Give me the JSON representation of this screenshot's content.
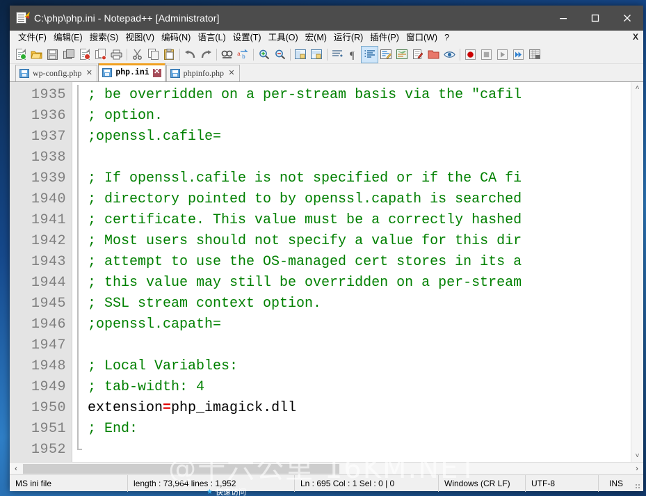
{
  "window": {
    "title": "C:\\php\\php.ini - Notepad++ [Administrator]",
    "icon": "notepad-pencil-icon",
    "controls": {
      "minimize": "–",
      "maximize": "□",
      "close": "✕"
    }
  },
  "menubar": {
    "items": [
      {
        "label": "文件(F)",
        "name": "menu-file"
      },
      {
        "label": "编辑(E)",
        "name": "menu-edit"
      },
      {
        "label": "搜索(S)",
        "name": "menu-search"
      },
      {
        "label": "视图(V)",
        "name": "menu-view"
      },
      {
        "label": "编码(N)",
        "name": "menu-encoding"
      },
      {
        "label": "语言(L)",
        "name": "menu-language"
      },
      {
        "label": "设置(T)",
        "name": "menu-settings"
      },
      {
        "label": "工具(O)",
        "name": "menu-tools"
      },
      {
        "label": "宏(M)",
        "name": "menu-macro"
      },
      {
        "label": "运行(R)",
        "name": "menu-run"
      },
      {
        "label": "插件(P)",
        "name": "menu-plugins"
      },
      {
        "label": "窗口(W)",
        "name": "menu-window"
      },
      {
        "label": "?",
        "name": "menu-help"
      }
    ],
    "close_doc_label": "X"
  },
  "toolbar": {
    "icons": [
      "new-file-icon",
      "open-file-icon",
      "save-icon",
      "save-all-icon",
      "close-file-icon",
      "close-all-icon",
      "print-icon",
      "cut-icon",
      "copy-icon",
      "paste-icon",
      "undo-icon",
      "redo-icon",
      "find-icon",
      "replace-icon",
      "zoom-in-icon",
      "zoom-out-icon",
      "sync-vertical-scroll-icon",
      "sync-horizontal-scroll-icon",
      "word-wrap-icon",
      "show-all-characters-icon",
      "indent-guide-icon",
      "user-defined-language-icon",
      "document-map-icon",
      "function-list-icon",
      "folder-as-workspace-icon",
      "monitoring-icon",
      "macro-record-icon",
      "macro-stop-icon",
      "macro-play-icon",
      "macro-playback-multiple-icon",
      "macro-save-icon"
    ]
  },
  "tabs": [
    {
      "label": "wp-config.php",
      "active": false,
      "modified": false,
      "name": "tab-wp-config-php"
    },
    {
      "label": "php.ini",
      "active": true,
      "modified": true,
      "name": "tab-php-ini"
    },
    {
      "label": "phpinfo.php",
      "active": false,
      "modified": false,
      "name": "tab-phpinfo-php"
    }
  ],
  "editor": {
    "first_line_number": 1935,
    "lines": [
      {
        "num": "1935",
        "segments": [
          {
            "cls": "cmt",
            "text": "; be overridden on a per-stream basis via the \"cafil"
          }
        ]
      },
      {
        "num": "1936",
        "segments": [
          {
            "cls": "cmt",
            "text": "; option."
          }
        ]
      },
      {
        "num": "1937",
        "segments": [
          {
            "cls": "cmt",
            "text": ";openssl.cafile="
          }
        ]
      },
      {
        "num": "1938",
        "segments": [
          {
            "cls": "cmt",
            "text": ""
          }
        ]
      },
      {
        "num": "1939",
        "segments": [
          {
            "cls": "cmt",
            "text": "; If openssl.cafile is not specified or if the CA fi"
          }
        ]
      },
      {
        "num": "1940",
        "segments": [
          {
            "cls": "cmt",
            "text": "; directory pointed to by openssl.capath is searched"
          }
        ]
      },
      {
        "num": "1941",
        "segments": [
          {
            "cls": "cmt",
            "text": "; certificate. This value must be a correctly hashed"
          }
        ]
      },
      {
        "num": "1942",
        "segments": [
          {
            "cls": "cmt",
            "text": "; Most users should not specify a value for this dir"
          }
        ]
      },
      {
        "num": "1943",
        "segments": [
          {
            "cls": "cmt",
            "text": "; attempt to use the OS-managed cert stores in its a"
          }
        ]
      },
      {
        "num": "1944",
        "segments": [
          {
            "cls": "cmt",
            "text": "; this value may still be overridden on a per-stream"
          }
        ]
      },
      {
        "num": "1945",
        "segments": [
          {
            "cls": "cmt",
            "text": "; SSL stream context option."
          }
        ]
      },
      {
        "num": "1946",
        "segments": [
          {
            "cls": "cmt",
            "text": ";openssl.capath="
          }
        ]
      },
      {
        "num": "1947",
        "segments": [
          {
            "cls": "cmt",
            "text": ""
          }
        ]
      },
      {
        "num": "1948",
        "segments": [
          {
            "cls": "cmt",
            "text": "; Local Variables:"
          }
        ]
      },
      {
        "num": "1949",
        "segments": [
          {
            "cls": "cmt",
            "text": "; tab-width: 4"
          }
        ]
      },
      {
        "num": "1950",
        "segments": [
          {
            "cls": "kw",
            "text": "extension"
          },
          {
            "cls": "eq",
            "text": "="
          },
          {
            "cls": "val",
            "text": "php_imagick.dll"
          }
        ]
      },
      {
        "num": "1951",
        "segments": [
          {
            "cls": "cmt",
            "text": "; End:"
          }
        ]
      },
      {
        "num": "1952",
        "segments": [
          {
            "cls": "cmt",
            "text": ""
          }
        ]
      }
    ],
    "scroll": {
      "up_arrow": "˄",
      "down_arrow": "˅",
      "left_arrow": "‹",
      "right_arrow": "›"
    }
  },
  "statusbar": {
    "filetype": "MS ini file",
    "length_lines": "length : 73,964     lines : 1,952",
    "position": "Ln : 695    Col : 1    Sel : 0 | 0",
    "eol": "Windows (CR LF)",
    "encoding": "UTF-8",
    "insert_mode": "INS"
  },
  "overlay": {
    "watermark": "@十六公里 16KM.NET",
    "taskbar_item": "快速访问"
  },
  "colors": {
    "titlebar": "#4c4c4c",
    "comment_green": "#008000",
    "equals_red": "#e00000",
    "tab_active_accent": "#f0a020",
    "gutter_bg": "#e4e4e4"
  }
}
